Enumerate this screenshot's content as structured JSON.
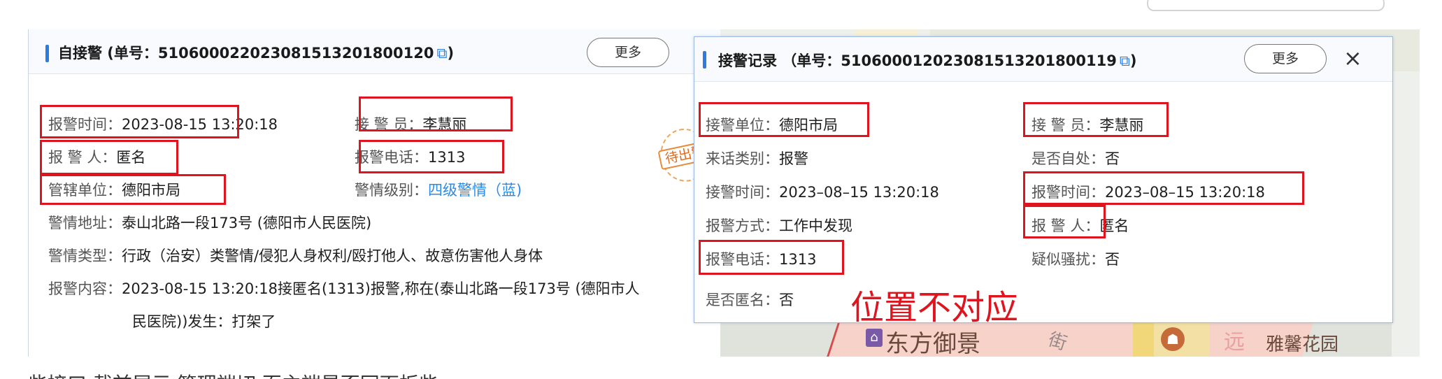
{
  "left_panel": {
    "title": "自接警 (单号：51060002202308151320180012​0",
    "title_clean": "自接警 (单号：510600022023081513201800120",
    "copy_icon": "copy-icon",
    "title_close": ")",
    "more_label": "更多",
    "stamp_label": "待出警",
    "fields": {
      "report_time_label": "报警时间：",
      "report_time_value": "2023-08-15 13:20:18",
      "operator_label": "接 警 员：",
      "operator_value": "李慧丽",
      "reporter_label": "报 警 人：",
      "reporter_value": "匿名",
      "phone_label": "报警电话：",
      "phone_value": "1313",
      "unit_label": "管辖单位：",
      "unit_value": "德阳市局",
      "level_label": "警情级别：",
      "level_value": "四级警情（蓝)",
      "address_label": "警情地址：",
      "address_value": "泰山北路一段173号 (德阳市人民医院)",
      "type_label": "警情类型：",
      "type_value": "行政（治安）类警情/侵犯人身权利/殴打他人、故意伤害他人身体",
      "content_label": "报警内容：",
      "content_value_1": "2023-08-15 13:20:18接匿名(1313)报警,称在(泰山北路一段173号 (德阳市人",
      "content_value_2": "民医院))发生：打架了"
    }
  },
  "right_panel": {
    "title_clean": "接警记录 （单号：510600012023081513201800119",
    "title_close": ")",
    "more_label": "更多",
    "close_label": "×",
    "fields": {
      "recv_unit_label": "接警单位：",
      "recv_unit_value": "德阳市局",
      "operator_label": "接 警 员：",
      "operator_value": "李慧丽",
      "call_type_label": "来话类别：",
      "call_type_value": "报警",
      "self_handle_label": "是否自处：",
      "self_handle_value": "否",
      "recv_time_label": "接警时间：",
      "recv_time_value": "2023–08–15 13:20:18",
      "report_time_label": "报警时间：",
      "report_time_value": "2023–08–15 13:20:18",
      "report_method_label": "报警方式：",
      "report_method_value": "工作中发现",
      "reporter_label": "报 警 人：",
      "reporter_value": "匿名",
      "phone_label": "报警电话：",
      "phone_value": "1313",
      "harass_label": "疑似骚扰：",
      "harass_value": "否",
      "anonymous_label": "是否匿名：",
      "anonymous_value": "否"
    }
  },
  "annotation": "位置不对应",
  "map_labels": {
    "poi_1": "东方御景",
    "street": "街",
    "poi_2": "远",
    "poi_3": "雅馨花园"
  },
  "bottom_text": "些接口 截前展示 管理端切 页主端是否同面板些"
}
